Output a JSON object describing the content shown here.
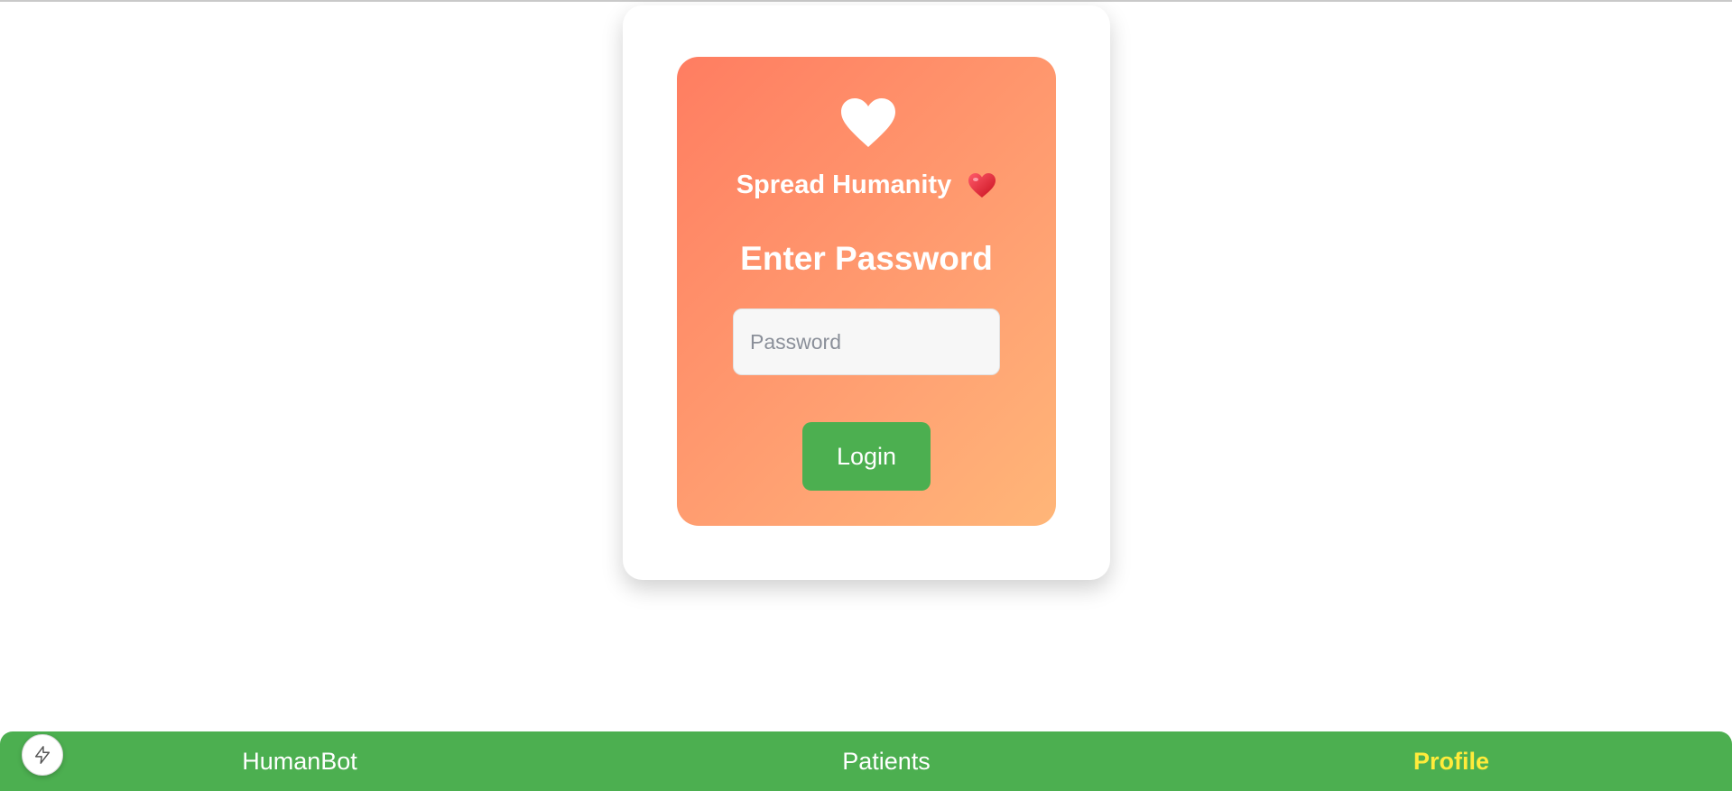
{
  "brand": {
    "name": "Spread Humanity",
    "logo_icon": "heart-icon",
    "emoji_icon": "red-heart-icon"
  },
  "login": {
    "title": "Enter Password",
    "password_placeholder": "Password",
    "password_value": "",
    "button_label": "Login"
  },
  "nav": {
    "items": [
      {
        "label": "HumanBot",
        "active": false
      },
      {
        "label": "Patients",
        "active": false
      },
      {
        "label": "Profile",
        "active": true
      }
    ],
    "active_color": "#ffeb3b"
  },
  "fab": {
    "icon": "lightning-icon"
  },
  "colors": {
    "accent_green": "#4caf50",
    "gradient_start": "#ff7d61",
    "gradient_end": "#ffb678"
  }
}
